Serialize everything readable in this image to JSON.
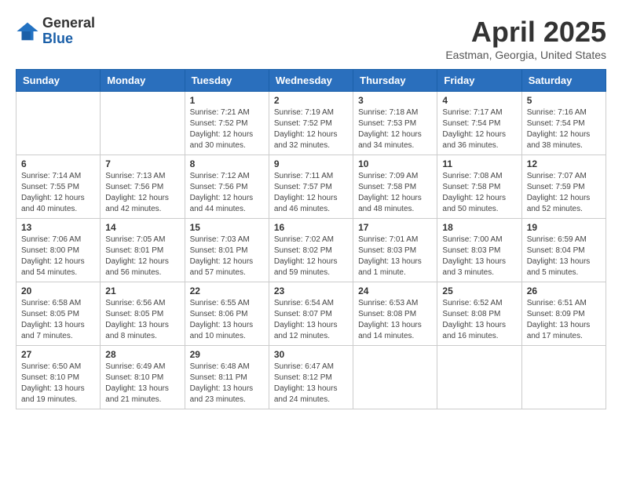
{
  "header": {
    "logo_general": "General",
    "logo_blue": "Blue",
    "month": "April 2025",
    "location": "Eastman, Georgia, United States"
  },
  "weekdays": [
    "Sunday",
    "Monday",
    "Tuesday",
    "Wednesday",
    "Thursday",
    "Friday",
    "Saturday"
  ],
  "weeks": [
    [
      {
        "day": "",
        "info": ""
      },
      {
        "day": "",
        "info": ""
      },
      {
        "day": "1",
        "info": "Sunrise: 7:21 AM\nSunset: 7:52 PM\nDaylight: 12 hours\nand 30 minutes."
      },
      {
        "day": "2",
        "info": "Sunrise: 7:19 AM\nSunset: 7:52 PM\nDaylight: 12 hours\nand 32 minutes."
      },
      {
        "day": "3",
        "info": "Sunrise: 7:18 AM\nSunset: 7:53 PM\nDaylight: 12 hours\nand 34 minutes."
      },
      {
        "day": "4",
        "info": "Sunrise: 7:17 AM\nSunset: 7:54 PM\nDaylight: 12 hours\nand 36 minutes."
      },
      {
        "day": "5",
        "info": "Sunrise: 7:16 AM\nSunset: 7:54 PM\nDaylight: 12 hours\nand 38 minutes."
      }
    ],
    [
      {
        "day": "6",
        "info": "Sunrise: 7:14 AM\nSunset: 7:55 PM\nDaylight: 12 hours\nand 40 minutes."
      },
      {
        "day": "7",
        "info": "Sunrise: 7:13 AM\nSunset: 7:56 PM\nDaylight: 12 hours\nand 42 minutes."
      },
      {
        "day": "8",
        "info": "Sunrise: 7:12 AM\nSunset: 7:56 PM\nDaylight: 12 hours\nand 44 minutes."
      },
      {
        "day": "9",
        "info": "Sunrise: 7:11 AM\nSunset: 7:57 PM\nDaylight: 12 hours\nand 46 minutes."
      },
      {
        "day": "10",
        "info": "Sunrise: 7:09 AM\nSunset: 7:58 PM\nDaylight: 12 hours\nand 48 minutes."
      },
      {
        "day": "11",
        "info": "Sunrise: 7:08 AM\nSunset: 7:58 PM\nDaylight: 12 hours\nand 50 minutes."
      },
      {
        "day": "12",
        "info": "Sunrise: 7:07 AM\nSunset: 7:59 PM\nDaylight: 12 hours\nand 52 minutes."
      }
    ],
    [
      {
        "day": "13",
        "info": "Sunrise: 7:06 AM\nSunset: 8:00 PM\nDaylight: 12 hours\nand 54 minutes."
      },
      {
        "day": "14",
        "info": "Sunrise: 7:05 AM\nSunset: 8:01 PM\nDaylight: 12 hours\nand 56 minutes."
      },
      {
        "day": "15",
        "info": "Sunrise: 7:03 AM\nSunset: 8:01 PM\nDaylight: 12 hours\nand 57 minutes."
      },
      {
        "day": "16",
        "info": "Sunrise: 7:02 AM\nSunset: 8:02 PM\nDaylight: 12 hours\nand 59 minutes."
      },
      {
        "day": "17",
        "info": "Sunrise: 7:01 AM\nSunset: 8:03 PM\nDaylight: 13 hours\nand 1 minute."
      },
      {
        "day": "18",
        "info": "Sunrise: 7:00 AM\nSunset: 8:03 PM\nDaylight: 13 hours\nand 3 minutes."
      },
      {
        "day": "19",
        "info": "Sunrise: 6:59 AM\nSunset: 8:04 PM\nDaylight: 13 hours\nand 5 minutes."
      }
    ],
    [
      {
        "day": "20",
        "info": "Sunrise: 6:58 AM\nSunset: 8:05 PM\nDaylight: 13 hours\nand 7 minutes."
      },
      {
        "day": "21",
        "info": "Sunrise: 6:56 AM\nSunset: 8:05 PM\nDaylight: 13 hours\nand 8 minutes."
      },
      {
        "day": "22",
        "info": "Sunrise: 6:55 AM\nSunset: 8:06 PM\nDaylight: 13 hours\nand 10 minutes."
      },
      {
        "day": "23",
        "info": "Sunrise: 6:54 AM\nSunset: 8:07 PM\nDaylight: 13 hours\nand 12 minutes."
      },
      {
        "day": "24",
        "info": "Sunrise: 6:53 AM\nSunset: 8:08 PM\nDaylight: 13 hours\nand 14 minutes."
      },
      {
        "day": "25",
        "info": "Sunrise: 6:52 AM\nSunset: 8:08 PM\nDaylight: 13 hours\nand 16 minutes."
      },
      {
        "day": "26",
        "info": "Sunrise: 6:51 AM\nSunset: 8:09 PM\nDaylight: 13 hours\nand 17 minutes."
      }
    ],
    [
      {
        "day": "27",
        "info": "Sunrise: 6:50 AM\nSunset: 8:10 PM\nDaylight: 13 hours\nand 19 minutes."
      },
      {
        "day": "28",
        "info": "Sunrise: 6:49 AM\nSunset: 8:10 PM\nDaylight: 13 hours\nand 21 minutes."
      },
      {
        "day": "29",
        "info": "Sunrise: 6:48 AM\nSunset: 8:11 PM\nDaylight: 13 hours\nand 23 minutes."
      },
      {
        "day": "30",
        "info": "Sunrise: 6:47 AM\nSunset: 8:12 PM\nDaylight: 13 hours\nand 24 minutes."
      },
      {
        "day": "",
        "info": ""
      },
      {
        "day": "",
        "info": ""
      },
      {
        "day": "",
        "info": ""
      }
    ]
  ]
}
